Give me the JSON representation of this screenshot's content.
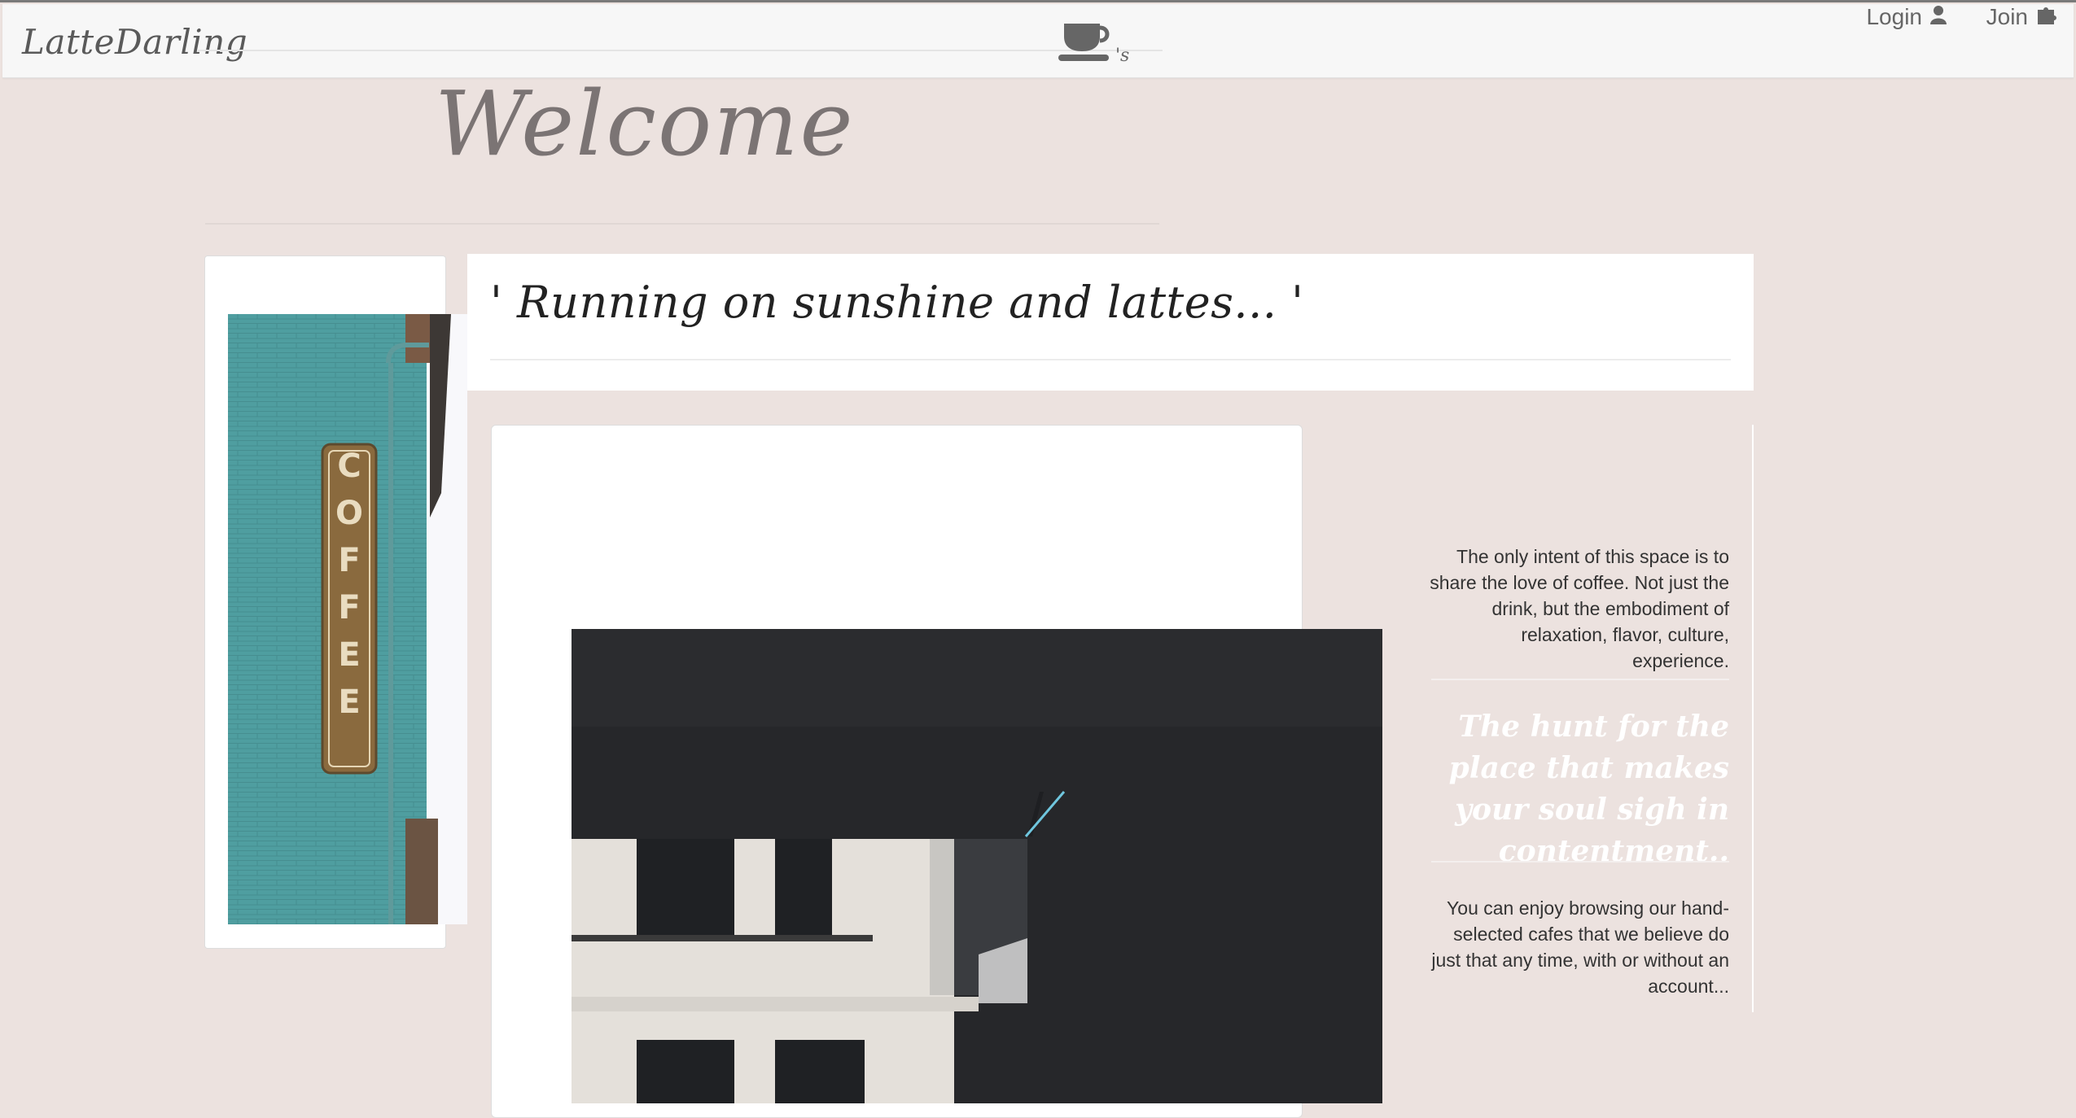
{
  "navbar": {
    "brand": "LatteDarling",
    "logo_icon": "coffee-cup-icon",
    "logo_suffix": "'s",
    "login_label": "Login",
    "login_icon": "user-icon",
    "join_label": "Join",
    "join_icon": "puzzle-icon"
  },
  "hero": {
    "title": "Welcome"
  },
  "quote": {
    "text": "' Running on sunshine and lattes... '"
  },
  "images": {
    "left": {
      "sign_text": "COFFEE",
      "wall_color": "#4f9ea0"
    },
    "main": {
      "dark_color": "#26272a"
    }
  },
  "sidebar": {
    "intro": "The only intent of this space is to share the love of coffee. Not just the drink, but the embodiment of relaxation, flavor, culture, experience.",
    "tagline": "The hunt for the place that makes your soul sigh in contentment..",
    "browse": "You can enjoy browsing our hand-selected cafes that we believe do just that any time, with or without an account..."
  },
  "colors": {
    "background": "#ece2df",
    "navbar": "#f7f7f7",
    "text_muted": "#666666"
  }
}
